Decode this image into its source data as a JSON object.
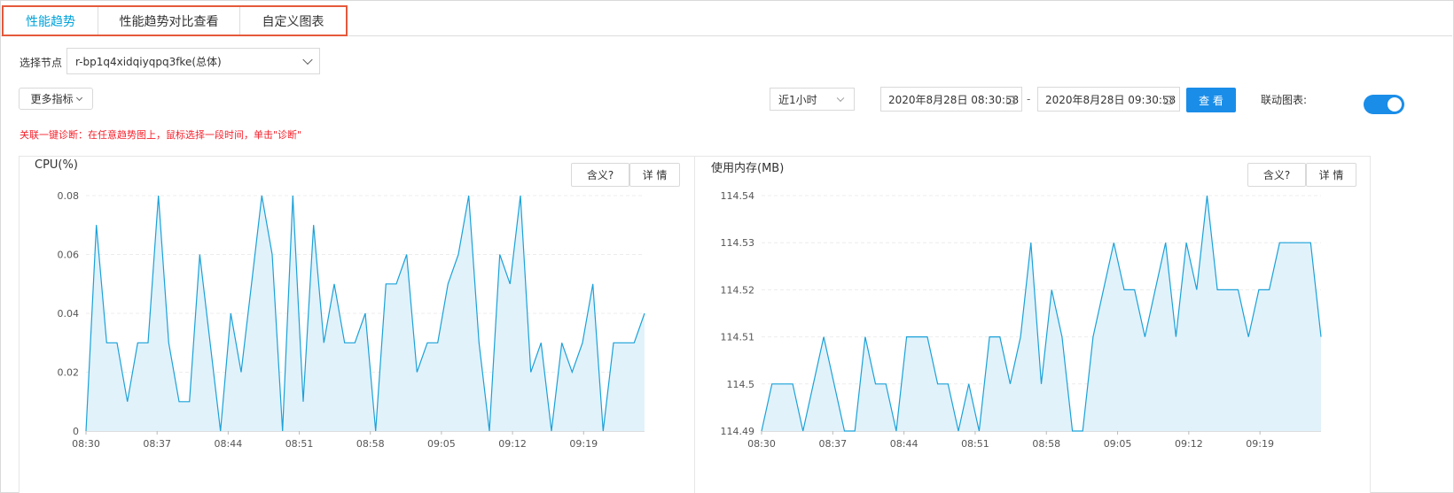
{
  "tabs": [
    {
      "label": "性能趋势",
      "active": true
    },
    {
      "label": "性能趋势对比查看",
      "active": false
    },
    {
      "label": "自定义图表",
      "active": false
    }
  ],
  "node": {
    "label": "选择节点",
    "value": "r-bp1q4xidqiyqpq3fke(总体)"
  },
  "more_metrics": "更多指标",
  "time_range": {
    "selected": "近1小时",
    "start": "2020年8月28日 08:30:58",
    "separator": "-",
    "end": "2020年8月28日 09:30:58",
    "query_button": "查 看"
  },
  "link_charts": {
    "label": "联动图表:",
    "enabled": true
  },
  "hint": "关联一键诊断：在任意趋势图上，鼠标选择一段时间，单击\"诊断\"",
  "panels": [
    {
      "title": "CPU(%)",
      "meaning_button": "含义?",
      "detail_button": "详 情"
    },
    {
      "title": "使用内存(MB)",
      "meaning_button": "含义?",
      "detail_button": "详 情"
    }
  ],
  "colors": {
    "accent": "#1a8de8",
    "active_tab": "#00a2d9",
    "tab_border": "#e4593b",
    "hint": "#f5222d",
    "line": "#1ba1d8",
    "area": "#e1f2fb"
  },
  "chart_data": [
    {
      "type": "area",
      "title": "CPU(%)",
      "xlabel": "",
      "ylabel": "",
      "x_ticks": [
        "08:30",
        "08:37",
        "08:44",
        "08:51",
        "08:58",
        "09:05",
        "09:12",
        "09:19"
      ],
      "y_ticks": [
        "0",
        "0.02",
        "0.04",
        "0.06",
        "0.08"
      ],
      "ylim": [
        0,
        0.08
      ],
      "x_start": "08:30",
      "x_end": "09:25",
      "grid": true,
      "series": [
        {
          "values": [
            0,
            0.07,
            0.03,
            0.03,
            0.01,
            0.03,
            0.03,
            0.08,
            0.03,
            0.01,
            0.01,
            0.06,
            0.03,
            0,
            0.04,
            0.02,
            0.05,
            0.08,
            0.06,
            0,
            0.08,
            0.01,
            0.07,
            0.03,
            0.05,
            0.03,
            0.03,
            0.04,
            0,
            0.05,
            0.05,
            0.06,
            0.02,
            0.03,
            0.03,
            0.05,
            0.06,
            0.08,
            0.03,
            0,
            0.06,
            0.05,
            0.08,
            0.02,
            0.03,
            0,
            0.03,
            0.02,
            0.03,
            0.05,
            0,
            0.03,
            0.03,
            0.03,
            0.04
          ]
        }
      ]
    },
    {
      "type": "area",
      "title": "使用内存(MB)",
      "xlabel": "",
      "ylabel": "",
      "x_ticks": [
        "08:30",
        "08:37",
        "08:44",
        "08:51",
        "08:58",
        "09:05",
        "09:12",
        "09:19"
      ],
      "y_ticks": [
        "114.49",
        "114.5",
        "114.51",
        "114.52",
        "114.53",
        "114.54"
      ],
      "ylim": [
        114.49,
        114.54
      ],
      "x_start": "08:30",
      "x_end": "09:25",
      "grid": true,
      "series": [
        {
          "values": [
            114.49,
            114.5,
            114.5,
            114.5,
            114.49,
            114.5,
            114.51,
            114.5,
            114.49,
            114.49,
            114.51,
            114.5,
            114.5,
            114.49,
            114.51,
            114.51,
            114.51,
            114.5,
            114.5,
            114.49,
            114.5,
            114.49,
            114.51,
            114.51,
            114.5,
            114.51,
            114.53,
            114.5,
            114.52,
            114.51,
            114.49,
            114.49,
            114.51,
            114.52,
            114.53,
            114.52,
            114.52,
            114.51,
            114.52,
            114.53,
            114.51,
            114.53,
            114.52,
            114.54,
            114.52,
            114.52,
            114.52,
            114.51,
            114.52,
            114.52,
            114.53,
            114.53,
            114.53,
            114.53,
            114.51
          ]
        }
      ]
    }
  ]
}
